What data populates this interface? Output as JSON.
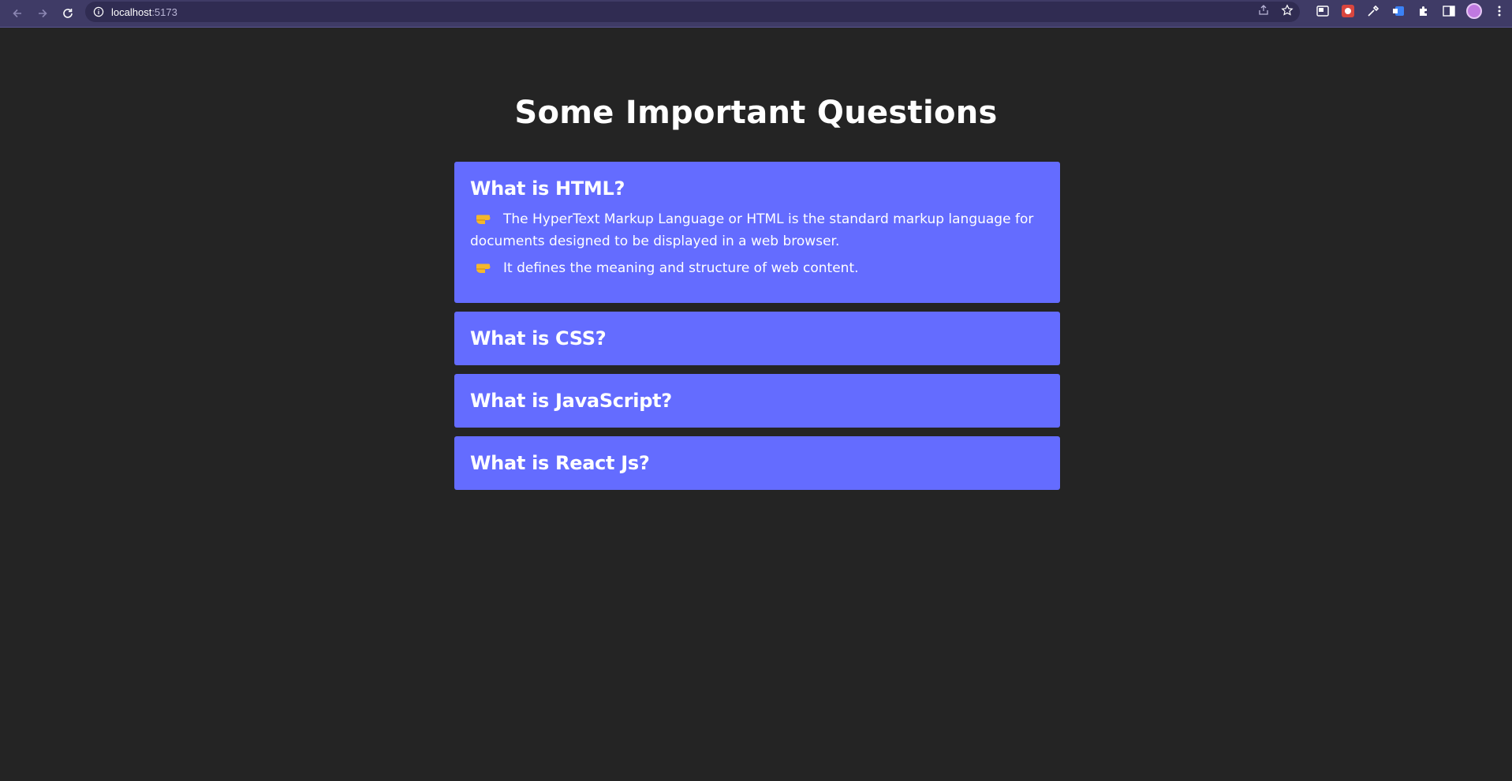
{
  "browser": {
    "url_host": "localhost",
    "url_port": ":5173"
  },
  "page": {
    "title": "Some Important Questions"
  },
  "accordion": {
    "items": [
      {
        "question": "What is HTML?",
        "expanded": true,
        "answers": [
          "The HyperText Markup Language or HTML is the standard markup language for documents designed to be displayed in a web browser.",
          "It defines the meaning and structure of web content."
        ]
      },
      {
        "question": "What is CSS?",
        "expanded": false
      },
      {
        "question": "What is JavaScript?",
        "expanded": false
      },
      {
        "question": "What is React Js?",
        "expanded": false
      }
    ]
  },
  "colors": {
    "background": "#242424",
    "card": "#646cff",
    "browser_bar": "#3f3b66",
    "pointer_emoji": "#f5b72c"
  },
  "icons": {
    "answer_bullet": "backhand-index-pointing-right-icon"
  }
}
